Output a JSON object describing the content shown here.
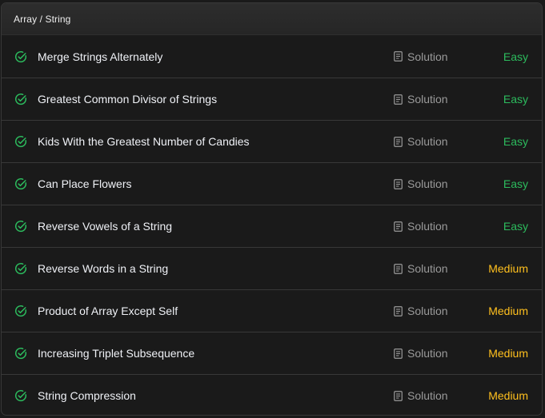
{
  "section": {
    "title": "Array / String"
  },
  "colors": {
    "easy": "#2cbb5d",
    "medium": "#ffc01e",
    "check": "#2cbb5d"
  },
  "problems": [
    {
      "title": "Merge Strings Alternately",
      "solution": "Solution",
      "difficulty": "Easy",
      "level": "easy",
      "status_icon": "check-circle-icon"
    },
    {
      "title": "Greatest Common Divisor of Strings",
      "solution": "Solution",
      "difficulty": "Easy",
      "level": "easy",
      "status_icon": "check-circle-icon"
    },
    {
      "title": "Kids With the Greatest Number of Candies",
      "solution": "Solution",
      "difficulty": "Easy",
      "level": "easy",
      "status_icon": "check-circle-icon"
    },
    {
      "title": "Can Place Flowers",
      "solution": "Solution",
      "difficulty": "Easy",
      "level": "easy",
      "status_icon": "check-circle-icon"
    },
    {
      "title": "Reverse Vowels of a String",
      "solution": "Solution",
      "difficulty": "Easy",
      "level": "easy",
      "status_icon": "check-circle-icon"
    },
    {
      "title": "Reverse Words in a String",
      "solution": "Solution",
      "difficulty": "Medium",
      "level": "medium",
      "status_icon": "check-circle-icon"
    },
    {
      "title": "Product of Array Except Self",
      "solution": "Solution",
      "difficulty": "Medium",
      "level": "medium",
      "status_icon": "check-circle-icon"
    },
    {
      "title": "Increasing Triplet Subsequence",
      "solution": "Solution",
      "difficulty": "Medium",
      "level": "medium",
      "status_icon": "check-circle-icon"
    },
    {
      "title": "String Compression",
      "solution": "Solution",
      "difficulty": "Medium",
      "level": "medium",
      "status_icon": "check-circle-icon"
    }
  ]
}
